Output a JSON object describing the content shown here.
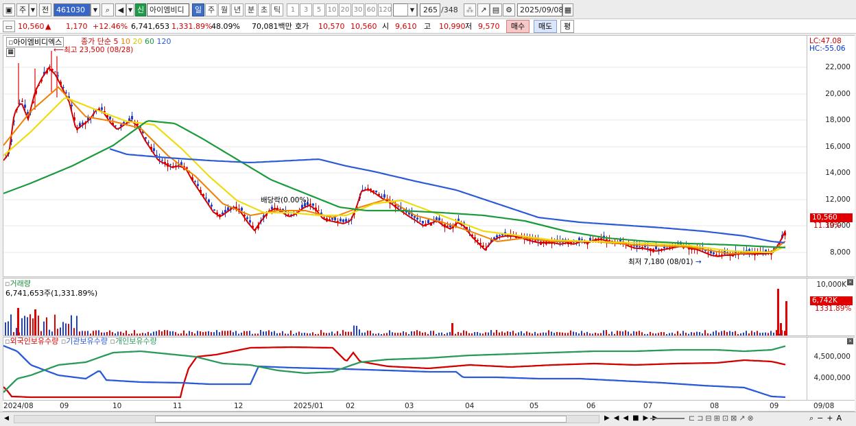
{
  "toolbar": {
    "period_short": "주",
    "prev_label": "전",
    "code": "461030",
    "sin_label": "신",
    "stock_name": "아이엠비디",
    "period_buttons": [
      "일",
      "주",
      "월",
      "년",
      "분",
      "초",
      "틱"
    ],
    "num_buttons": [
      "1",
      "3",
      "5",
      "10",
      "20",
      "30",
      "60",
      "120"
    ],
    "count": "265",
    "total": "/348",
    "date": "2025/09/08"
  },
  "quote": {
    "price": "10,560",
    "arrow": "▲",
    "change": "1,170",
    "change_pct": "+12.46%",
    "volume": "6,741,653",
    "vol_ratio": "1,331.89%",
    "turnover": "48.09%",
    "amount": "70,081백만",
    "hoga_label": "호가",
    "ask": "10,570",
    "bid": "10,560",
    "open_label": "시",
    "open": "9,610",
    "high_label": "고",
    "high": "10,990",
    "low_label": "저",
    "low": "9,570",
    "buy_label": "매수",
    "sell_label": "매도",
    "eval_label": "평"
  },
  "price_panel": {
    "name_tag": "아이엠비디엑스",
    "ma_title": "종가 단순",
    "ma_periods": [
      "5",
      "10",
      "20",
      "60",
      "120"
    ],
    "ma_colors": [
      "#d40000",
      "#f08000",
      "#e8d800",
      "#1a9a3a",
      "#2a5ad8"
    ],
    "high_note": "최고 23,500 (08/28)",
    "low_note": "최저 7,180 (08/01)",
    "dividend_note": "배당락(0.00%)",
    "lc": "LC:47.08",
    "hc": "HC:-55.06",
    "y_ticks": [
      "22,000",
      "20,000",
      "18,000",
      "16,000",
      "14,000",
      "12,000",
      "10,000",
      "8,000"
    ],
    "cur_badge": "10,560",
    "cur_pct": "11.39%"
  },
  "volume_panel": {
    "title": "거래량",
    "info": "6,741,653주(1,331.89%)",
    "y_top": "10,000K",
    "badge": "6,742K",
    "pct": "1331.89%"
  },
  "holdings_panel": {
    "series": [
      "외국인보유수량",
      "기관보유수량",
      "개인보유수량"
    ],
    "colors": [
      "#d40000",
      "#2a5ad8",
      "#2a9a5a"
    ],
    "y_ticks": [
      "4,500,000",
      "4,000,000"
    ]
  },
  "x_labels": [
    "2024/08",
    "09",
    "10",
    "11",
    "12",
    "2025/01",
    "02",
    "03",
    "04",
    "05",
    "06",
    "07",
    "08",
    "09",
    "09/08"
  ]
}
